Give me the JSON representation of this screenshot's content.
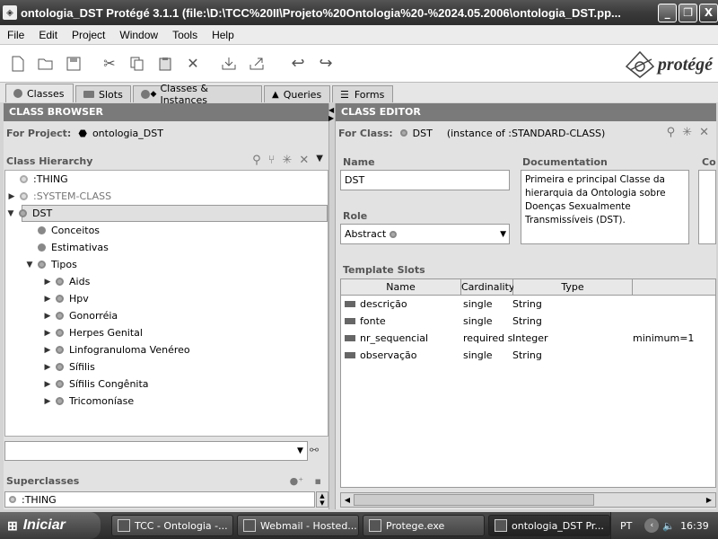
{
  "window": {
    "title": "ontologia_DST  Protégé 3.1.1     (file:\\D:\\TCC%20II\\Projeto%20Ontologia%20-%2024.05.2006\\ontologia_DST.pp...",
    "min_label": "_",
    "max_label": "❐",
    "close_label": "X"
  },
  "menu": [
    "File",
    "Edit",
    "Project",
    "Window",
    "Tools",
    "Help"
  ],
  "logo": {
    "text": "protégé"
  },
  "tabs": [
    {
      "label": "Classes",
      "icon": "circle-icon",
      "active": true
    },
    {
      "label": "Slots",
      "icon": "slot-icon"
    },
    {
      "label": "Classes & Instances",
      "icon": "circle-diamond-icon"
    },
    {
      "label": "Queries",
      "icon": "query-icon"
    },
    {
      "label": "Forms",
      "icon": "form-icon"
    }
  ],
  "class_browser": {
    "header": "CLASS BROWSER",
    "for_project_label": "For Project:",
    "project_name": "ontologia_DST",
    "hierarchy_label": "Class Hierarchy",
    "tree": [
      {
        "label": ":THING",
        "level": 0,
        "expander": ""
      },
      {
        "label": ":SYSTEM-CLASS",
        "level": 0,
        "expander": "▶",
        "muted": true
      },
      {
        "label": "DST",
        "level": 0,
        "expander": "▼",
        "selected": true
      },
      {
        "label": "Conceitos",
        "level": 1,
        "expander": ""
      },
      {
        "label": "Estimativas",
        "level": 1,
        "expander": ""
      },
      {
        "label": "Tipos",
        "level": 1,
        "expander": "▼"
      },
      {
        "label": "Aids",
        "level": 2,
        "expander": "▶"
      },
      {
        "label": "Hpv",
        "level": 2,
        "expander": "▶"
      },
      {
        "label": "Gonorréia",
        "level": 2,
        "expander": "▶"
      },
      {
        "label": "Herpes Genital",
        "level": 2,
        "expander": "▶"
      },
      {
        "label": "Linfogranuloma Venéreo",
        "level": 2,
        "expander": "▶"
      },
      {
        "label": "Sífilis",
        "level": 2,
        "expander": "▶"
      },
      {
        "label": "Sífilis Congênita",
        "level": 2,
        "expander": "▶"
      },
      {
        "label": "Tricomoníase",
        "level": 2,
        "expander": "▶"
      }
    ],
    "superclasses_label": "Superclasses",
    "superclass": ":THING"
  },
  "class_editor": {
    "header": "CLASS EDITOR",
    "for_class_label": "For Class:",
    "class_name": "DST",
    "instance_of": "(instance of :STANDARD-CLASS)",
    "name_label": "Name",
    "name_value": "DST",
    "documentation_label": "Documentation",
    "documentation": "Primeira e principal Classe da hierarquia da Ontologia sobre Doenças Sexualmente Transmissíveis (DST).",
    "cut_label": "Co",
    "role_label": "Role",
    "role_value": "Abstract",
    "template_slots_label": "Template Slots",
    "columns": [
      "Name",
      "Cardinality",
      "Type",
      ""
    ],
    "slots": [
      {
        "name": "descrição",
        "cardinality": "single",
        "type": "String",
        "other": ""
      },
      {
        "name": "fonte",
        "cardinality": "single",
        "type": "String",
        "other": ""
      },
      {
        "name": "nr_sequencial",
        "cardinality": "required s...",
        "type": "Integer",
        "other": "minimum=1"
      },
      {
        "name": "observação",
        "cardinality": "single",
        "type": "String",
        "other": ""
      }
    ]
  },
  "taskbar": {
    "start": "Iniciar",
    "tasks": [
      {
        "label": "TCC - Ontologia -..."
      },
      {
        "label": "Webmail - Hosted..."
      },
      {
        "label": "Protege.exe"
      },
      {
        "label": "ontologia_DST  Pr...",
        "active": true
      }
    ],
    "lang": "PT",
    "time": "16:39"
  }
}
